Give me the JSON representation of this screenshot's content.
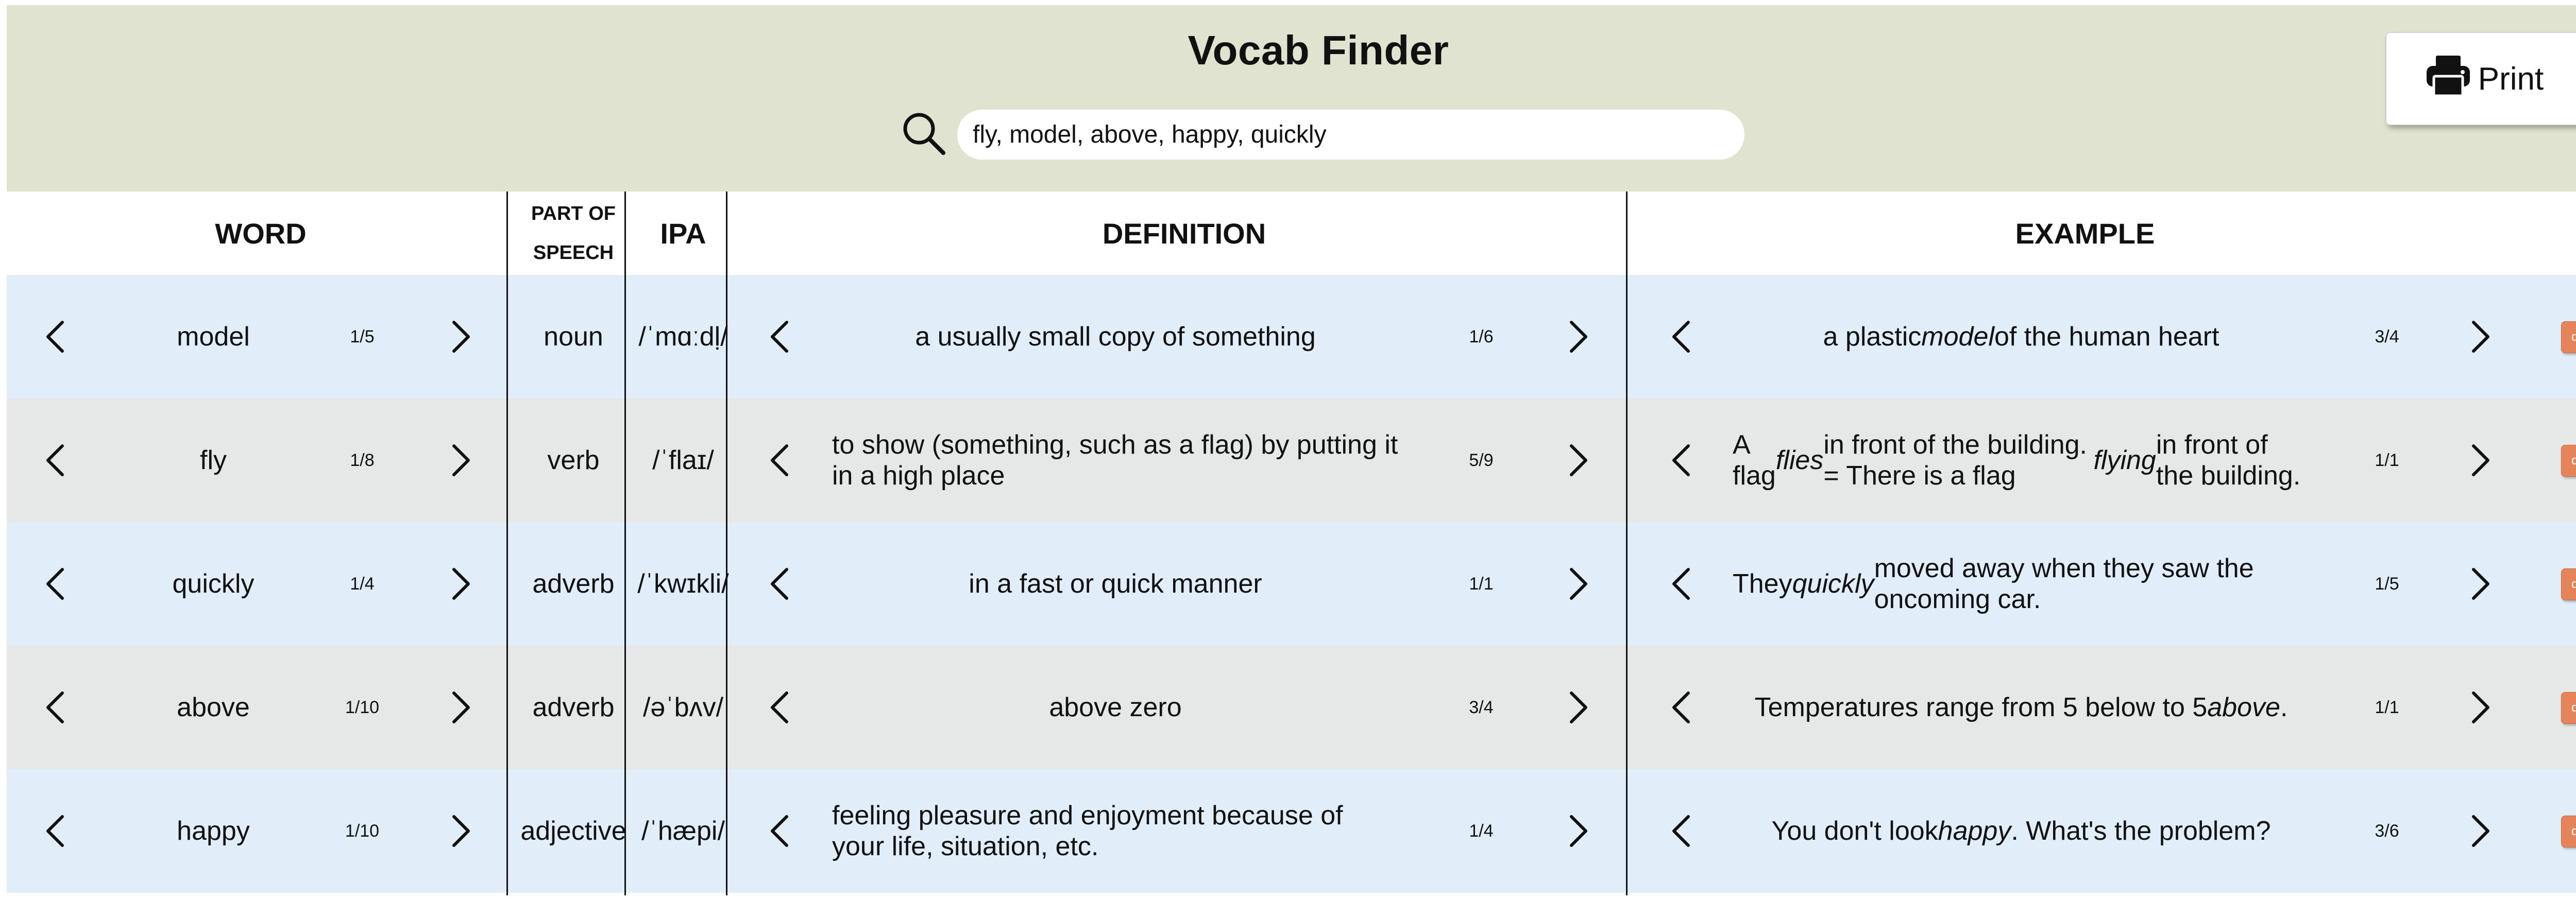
{
  "header": {
    "title": "Vocab Finder",
    "search_value": "fly, model, above, happy, quickly",
    "print_label": "Print",
    "search_icon": "search-icon",
    "print_icon": "printer-icon",
    "background_color": "#e0e3cf"
  },
  "table": {
    "columns": {
      "word": "WORD",
      "pos_line1": "PART OF",
      "pos_line2": "SPEECH",
      "ipa": "IPA",
      "definition": "DEFINITION",
      "example": "EXAMPLE"
    },
    "del_label": "del",
    "prev_icon": "chevron-left-icon",
    "next_icon": "chevron-right-icon",
    "row_colors": {
      "light": "#e1eef9",
      "gray": "#e6e8e8"
    },
    "del_color": "#e5845a",
    "rows": [
      {
        "word": "model",
        "word_count": "1/5",
        "pos": "noun",
        "ipa": "/ˈmɑːdḷ/",
        "definition": "a usually small copy of something",
        "definition_count": "1/6",
        "example_html": "a plastic <i>model</i> of the human heart",
        "example_count": "3/4",
        "def_left": false,
        "ex_left": false
      },
      {
        "word": "fly",
        "word_count": "1/8",
        "pos": "verb",
        "ipa": "/ˈflaɪ/",
        "definition": "to show (something, such as a flag) by putting it in a high place",
        "definition_count": "5/9",
        "example_html": "A flag <i>flies</i> in front of the building. = There is a flag <i>flying</i> in front of the building.",
        "example_count": "1/1",
        "def_left": true,
        "ex_left": true
      },
      {
        "word": "quickly",
        "word_count": "1/4",
        "pos": "adverb",
        "ipa": "/ˈkwɪkli/",
        "definition": "in a fast or quick manner",
        "definition_count": "1/1",
        "example_html": "They <i>quickly</i> moved away when they saw the oncoming car.",
        "example_count": "1/5",
        "def_left": false,
        "ex_left": true
      },
      {
        "word": "above",
        "word_count": "1/10",
        "pos": "adverb",
        "ipa": "/əˈbʌv/",
        "definition": "above zero",
        "definition_count": "3/4",
        "example_html": "Temperatures range from 5 below to 5 <i>above</i>.",
        "example_count": "1/1",
        "def_left": false,
        "ex_left": false
      },
      {
        "word": "happy",
        "word_count": "1/10",
        "pos": "adjective",
        "ipa": "/ˈhæpi/",
        "definition": "feeling pleasure and enjoyment because of your life, situation, etc.",
        "definition_count": "1/4",
        "example_html": "You don't look <i>happy</i>. What's the problem?",
        "example_count": "3/6",
        "def_left": true,
        "ex_left": false
      }
    ]
  }
}
